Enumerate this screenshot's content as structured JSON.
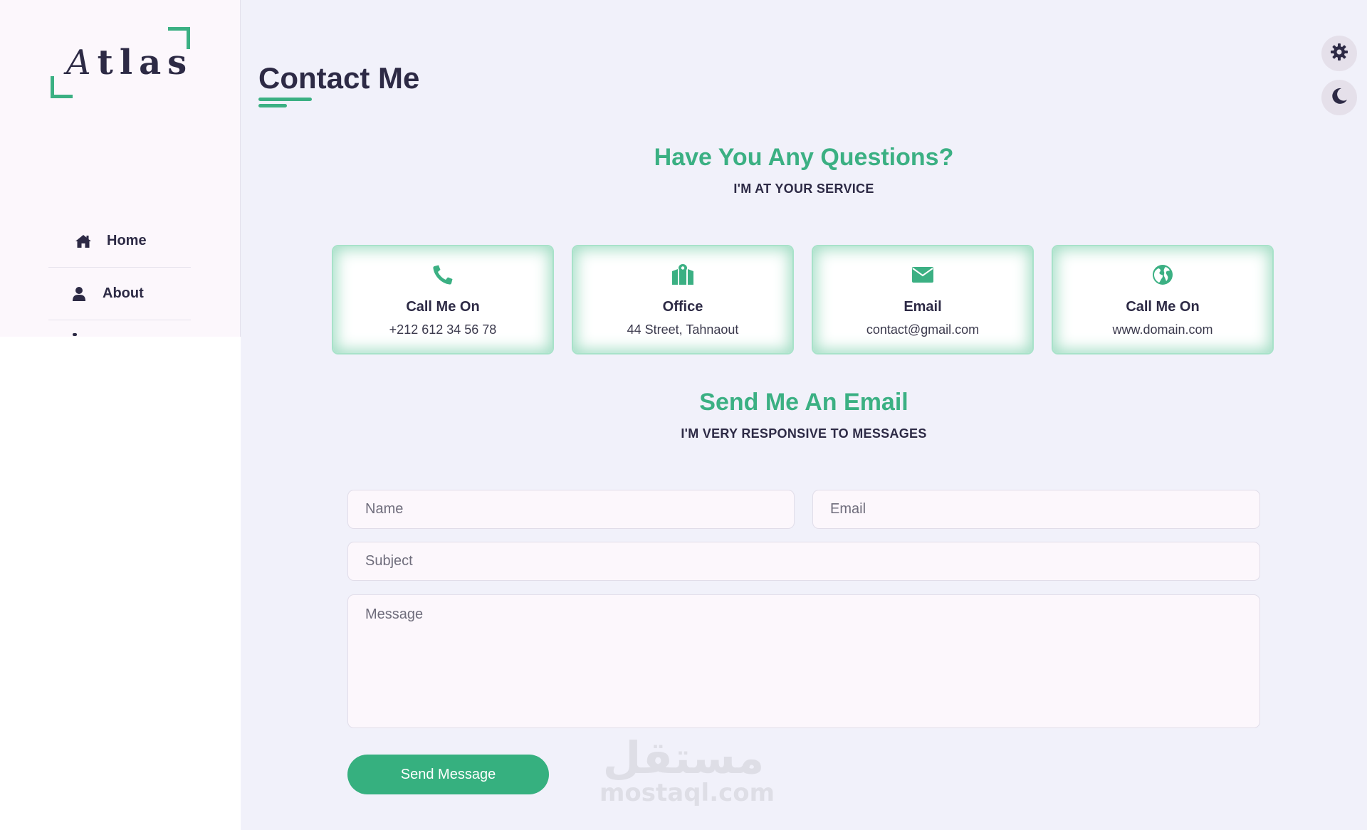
{
  "brand": {
    "logo_first": "A",
    "logo_rest": "tlas",
    "accent": "#3bb083"
  },
  "sidebar": {
    "items": [
      {
        "label": "Home",
        "icon": "home-icon"
      },
      {
        "label": "About",
        "icon": "user-icon"
      }
    ]
  },
  "header": {
    "title": "Contact Me"
  },
  "questions": {
    "heading": "Have You Any Questions?",
    "subheading": "I'M AT YOUR SERVICE"
  },
  "cards": [
    {
      "icon": "phone-icon",
      "title": "Call Me On",
      "value": "+212 612 34 56 78"
    },
    {
      "icon": "map-icon",
      "title": "Office",
      "value": "44 Street, Tahnaout"
    },
    {
      "icon": "envelope-icon",
      "title": "Email",
      "value": "contact@gmail.com"
    },
    {
      "icon": "globe-icon",
      "title": "Call Me On",
      "value": "www.domain.com"
    }
  ],
  "email_section": {
    "heading": "Send Me An Email",
    "subheading": "I'M VERY RESPONSIVE TO MESSAGES"
  },
  "form": {
    "name_placeholder": "Name",
    "email_placeholder": "Email",
    "subject_placeholder": "Subject",
    "message_placeholder": "Message",
    "send_label": "Send Message"
  },
  "watermark": {
    "arabic": "مستقل",
    "latin": "mostaql.com"
  }
}
